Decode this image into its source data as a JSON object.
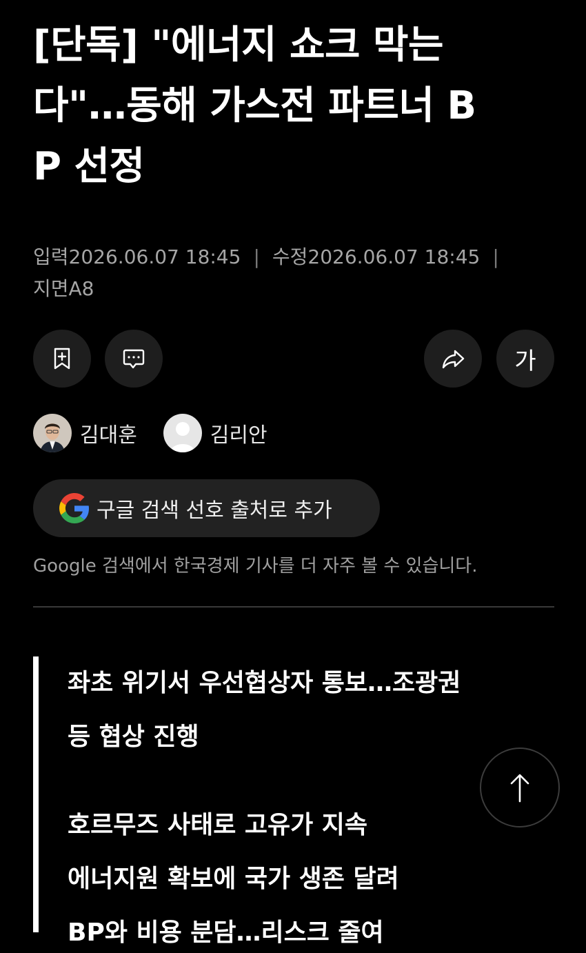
{
  "article": {
    "headline_line1": "[단독] \"에너지 쇼크 막는",
    "headline_line2": "다\"…동해 가스전 파트너 B",
    "headline_line3": "P 선정",
    "input_label": "입력",
    "input_datetime": "2026.06.07 18:45",
    "edit_label": "수정",
    "edit_datetime": "2026.06.07 18:45",
    "separator": "|",
    "page_label": "지면A8"
  },
  "actions": {
    "bookmark_icon": "bookmark-plus-icon",
    "comment_icon": "comment-icon",
    "share_icon": "share-icon",
    "font_size_label": "가"
  },
  "authors": [
    {
      "name": "김대훈",
      "avatar": "photo"
    },
    {
      "name": "김리안",
      "avatar": "placeholder"
    }
  ],
  "google": {
    "button_label": "구글 검색 선호 출처로 추가",
    "note": "Google 검색에서 한국경제 기사를 더 자주 볼 수 있습니다.",
    "colors": {
      "blue": "#4285F4",
      "red": "#EA4335",
      "yellow": "#FBBC05",
      "green": "#34A853"
    }
  },
  "summary": {
    "lines_a": [
      "좌초 위기서 우선협상자 통보…조광권",
      "등 협상 진행"
    ],
    "lines_b": [
      "호르무즈 사태로 고유가 지속",
      "에너지원 확보에 국가 생존 달려",
      "BP와 비용 분담…리스크 줄여"
    ]
  },
  "scroll_top_icon": "arrow-up-icon"
}
